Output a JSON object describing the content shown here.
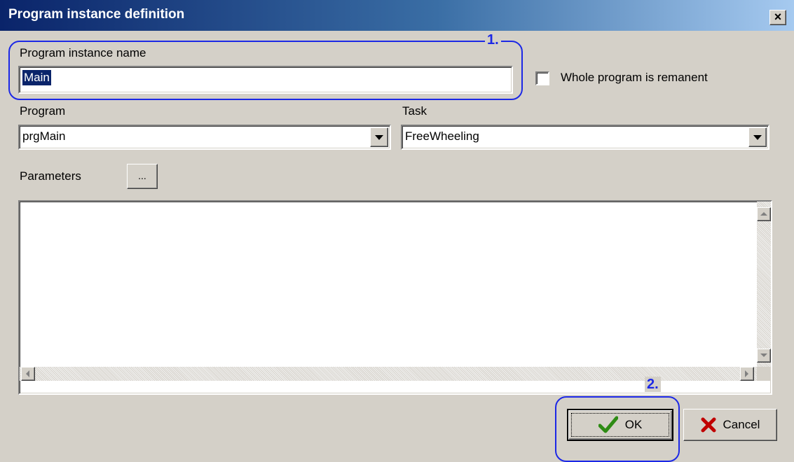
{
  "dialog": {
    "title": "Program instance definition",
    "close_glyph": "×"
  },
  "instance_name": {
    "label": "Program instance name",
    "value": "Main"
  },
  "remanent_checkbox": {
    "label": "Whole program is remanent",
    "checked": false
  },
  "program": {
    "label": "Program",
    "selected": "prgMain"
  },
  "task": {
    "label": "Task",
    "selected": "FreeWheeling"
  },
  "parameters": {
    "label": "Parameters",
    "button_label": "..."
  },
  "callouts": {
    "step1": "1.",
    "step2": "2."
  },
  "buttons": {
    "ok": "OK",
    "cancel": "Cancel"
  },
  "icons": {
    "ok": "checkmark-icon",
    "cancel": "x-icon",
    "accent": "#1c28e6",
    "ok_color": "#2e8b14",
    "cancel_color": "#c00000"
  }
}
